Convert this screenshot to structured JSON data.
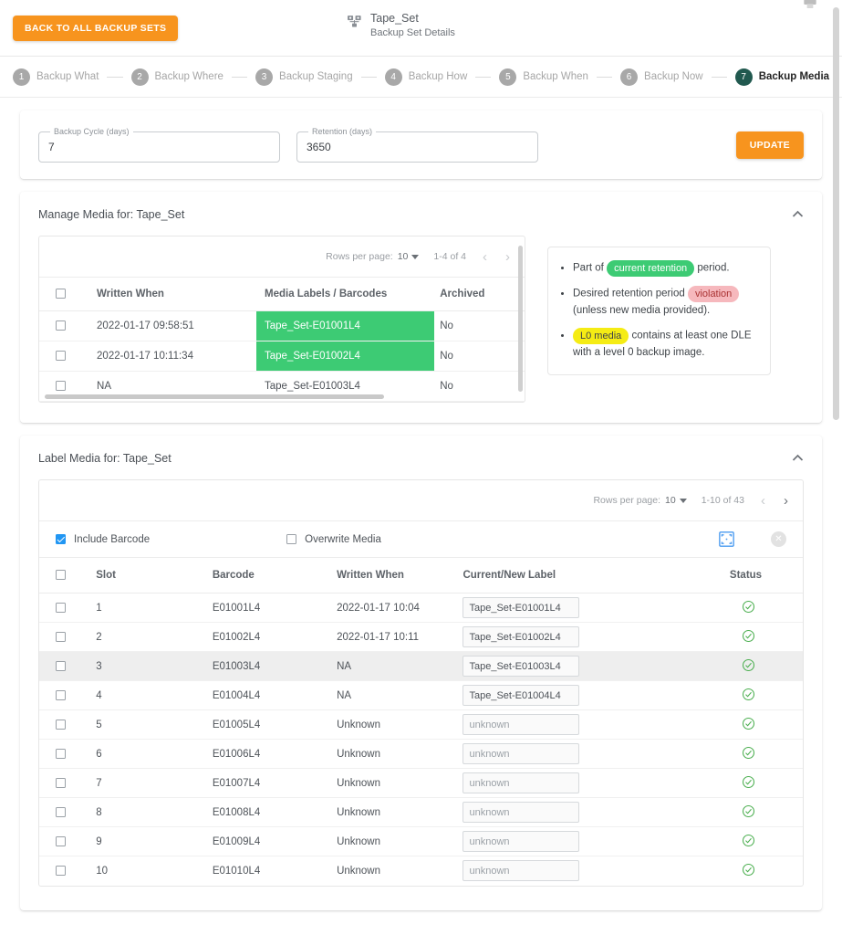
{
  "topbar": {
    "back_label": "BACK TO ALL BACKUP SETS",
    "title": "Tape_Set",
    "subtitle": "Backup Set Details",
    "tape_icon": "tape-library-icon",
    "top_right_icon": "printer-icon"
  },
  "stepper": {
    "steps": [
      {
        "num": "1",
        "label": "Backup What",
        "active": false
      },
      {
        "num": "2",
        "label": "Backup Where",
        "active": false
      },
      {
        "num": "3",
        "label": "Backup Staging",
        "active": false
      },
      {
        "num": "4",
        "label": "Backup How",
        "active": false
      },
      {
        "num": "5",
        "label": "Backup When",
        "active": false
      },
      {
        "num": "6",
        "label": "Backup Now",
        "active": false
      },
      {
        "num": "7",
        "label": "Backup Media",
        "active": true
      }
    ],
    "active_color": "#21594f",
    "inactive_color": "#a8a8a8"
  },
  "cycle_card": {
    "backup_cycle_label": "Backup Cycle (days)",
    "backup_cycle_value": "7",
    "retention_label": "Retention (days)",
    "retention_value": "3650",
    "update_label": "UPDATE",
    "accent_color": "#f7941e"
  },
  "manage_media": {
    "panel_title": "Manage Media for: Tape_Set",
    "chevron": "chevron-up-icon",
    "paginator": {
      "rows_per_page_label": "Rows per page:",
      "rows_per_page_value": "10",
      "range": "1-4 of 4",
      "prev": "‹",
      "next": "›"
    },
    "columns": [
      "",
      "Written When",
      "Media Labels / Barcodes",
      "Archived"
    ],
    "rows": [
      {
        "written_when": "2022-01-17 09:58:51",
        "label": "Tape_Set-E01001L4",
        "highlight": "green",
        "archived": "No"
      },
      {
        "written_when": "2022-01-17 10:11:34",
        "label": "Tape_Set-E01002L4",
        "highlight": "green",
        "archived": "No"
      },
      {
        "written_when": "NA",
        "label": "Tape_Set-E01003L4",
        "highlight": "none",
        "archived": "No"
      }
    ]
  },
  "legend": {
    "items": [
      {
        "pre": "Part of ",
        "pill": "current retention",
        "pill_color": "green",
        "post": " period."
      },
      {
        "pre": "Desired retention period ",
        "pill": "violation",
        "pill_color": "red",
        "post": " (unless new media provided)."
      },
      {
        "pre": "",
        "pill": "L0 media",
        "pill_color": "yellow",
        "post": " contains at least one DLE with a level 0 backup image."
      }
    ],
    "colors": {
      "green": "#3dcb74",
      "red": "#f6b8bd",
      "yellow": "#f5ec14"
    }
  },
  "label_media": {
    "panel_title": "Label Media for: Tape_Set",
    "chevron": "chevron-up-icon",
    "paginator": {
      "rows_per_page_label": "Rows per page:",
      "rows_per_page_value": "10",
      "range": "1-10 of 43",
      "prev": "‹",
      "next": "›"
    },
    "options": {
      "include_barcode_label": "Include Barcode",
      "include_barcode_checked": true,
      "overwrite_media_label": "Overwrite Media",
      "overwrite_media_checked": false,
      "scan_icon": "scan-media-icon",
      "clear_icon": "clear-circle-icon"
    },
    "columns": [
      "",
      "Slot",
      "Barcode",
      "Written When",
      "Current/New Label",
      "Status"
    ],
    "rows": [
      {
        "slot": "1",
        "barcode": "E01001L4",
        "written_when": "2022-01-17 10:04",
        "label": "Tape_Set-E01001L4",
        "is_placeholder": false,
        "status": "ok",
        "highlight": false
      },
      {
        "slot": "2",
        "barcode": "E01002L4",
        "written_when": "2022-01-17 10:11",
        "label": "Tape_Set-E01002L4",
        "is_placeholder": false,
        "status": "ok",
        "highlight": false
      },
      {
        "slot": "3",
        "barcode": "E01003L4",
        "written_when": "NA",
        "label": "Tape_Set-E01003L4",
        "is_placeholder": false,
        "status": "ok",
        "highlight": true
      },
      {
        "slot": "4",
        "barcode": "E01004L4",
        "written_when": "NA",
        "label": "Tape_Set-E01004L4",
        "is_placeholder": false,
        "status": "ok",
        "highlight": false
      },
      {
        "slot": "5",
        "barcode": "E01005L4",
        "written_when": "Unknown",
        "label": "unknown",
        "is_placeholder": true,
        "status": "ok",
        "highlight": false
      },
      {
        "slot": "6",
        "barcode": "E01006L4",
        "written_when": "Unknown",
        "label": "unknown",
        "is_placeholder": true,
        "status": "ok",
        "highlight": false
      },
      {
        "slot": "7",
        "barcode": "E01007L4",
        "written_when": "Unknown",
        "label": "unknown",
        "is_placeholder": true,
        "status": "ok",
        "highlight": false
      },
      {
        "slot": "8",
        "barcode": "E01008L4",
        "written_when": "Unknown",
        "label": "unknown",
        "is_placeholder": true,
        "status": "ok",
        "highlight": false
      },
      {
        "slot": "9",
        "barcode": "E01009L4",
        "written_when": "Unknown",
        "label": "unknown",
        "is_placeholder": true,
        "status": "ok",
        "highlight": false
      },
      {
        "slot": "10",
        "barcode": "E01010L4",
        "written_when": "Unknown",
        "label": "unknown",
        "is_placeholder": true,
        "status": "ok",
        "highlight": false
      }
    ],
    "status_icon": "check-circle-icon",
    "status_color": "#4caf50"
  }
}
